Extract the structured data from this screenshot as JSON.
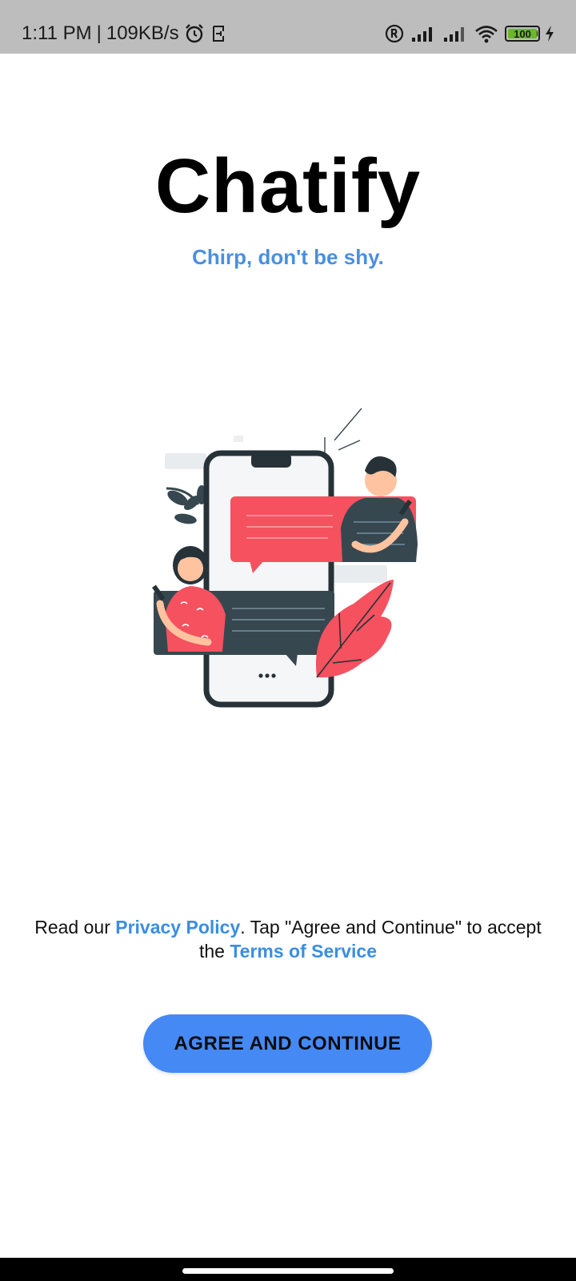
{
  "status_bar": {
    "time": "1:11 PM",
    "separator": "|",
    "speed": "109KB/s",
    "battery": "100",
    "icons": [
      "alarm-icon",
      "sim-icon",
      "registered-icon",
      "signal-icon",
      "signal-icon",
      "wifi-icon",
      "battery-icon",
      "charging-icon"
    ]
  },
  "app": {
    "title": "Chatify",
    "tagline": "Chirp, don't be shy."
  },
  "consent": {
    "prefix": "Read our ",
    "privacy_link": "Privacy Policy",
    "middle": ". Tap \"Agree and Continue\" to accept the ",
    "terms_link": "Terms of Service"
  },
  "button": {
    "label": "AGREE AND CONTINUE"
  },
  "colors": {
    "accent": "#4589f5",
    "link": "#3a8ee0",
    "tagline": "#4a8fdf",
    "illustration_red": "#f5515f",
    "illustration_dark": "#37474f"
  }
}
